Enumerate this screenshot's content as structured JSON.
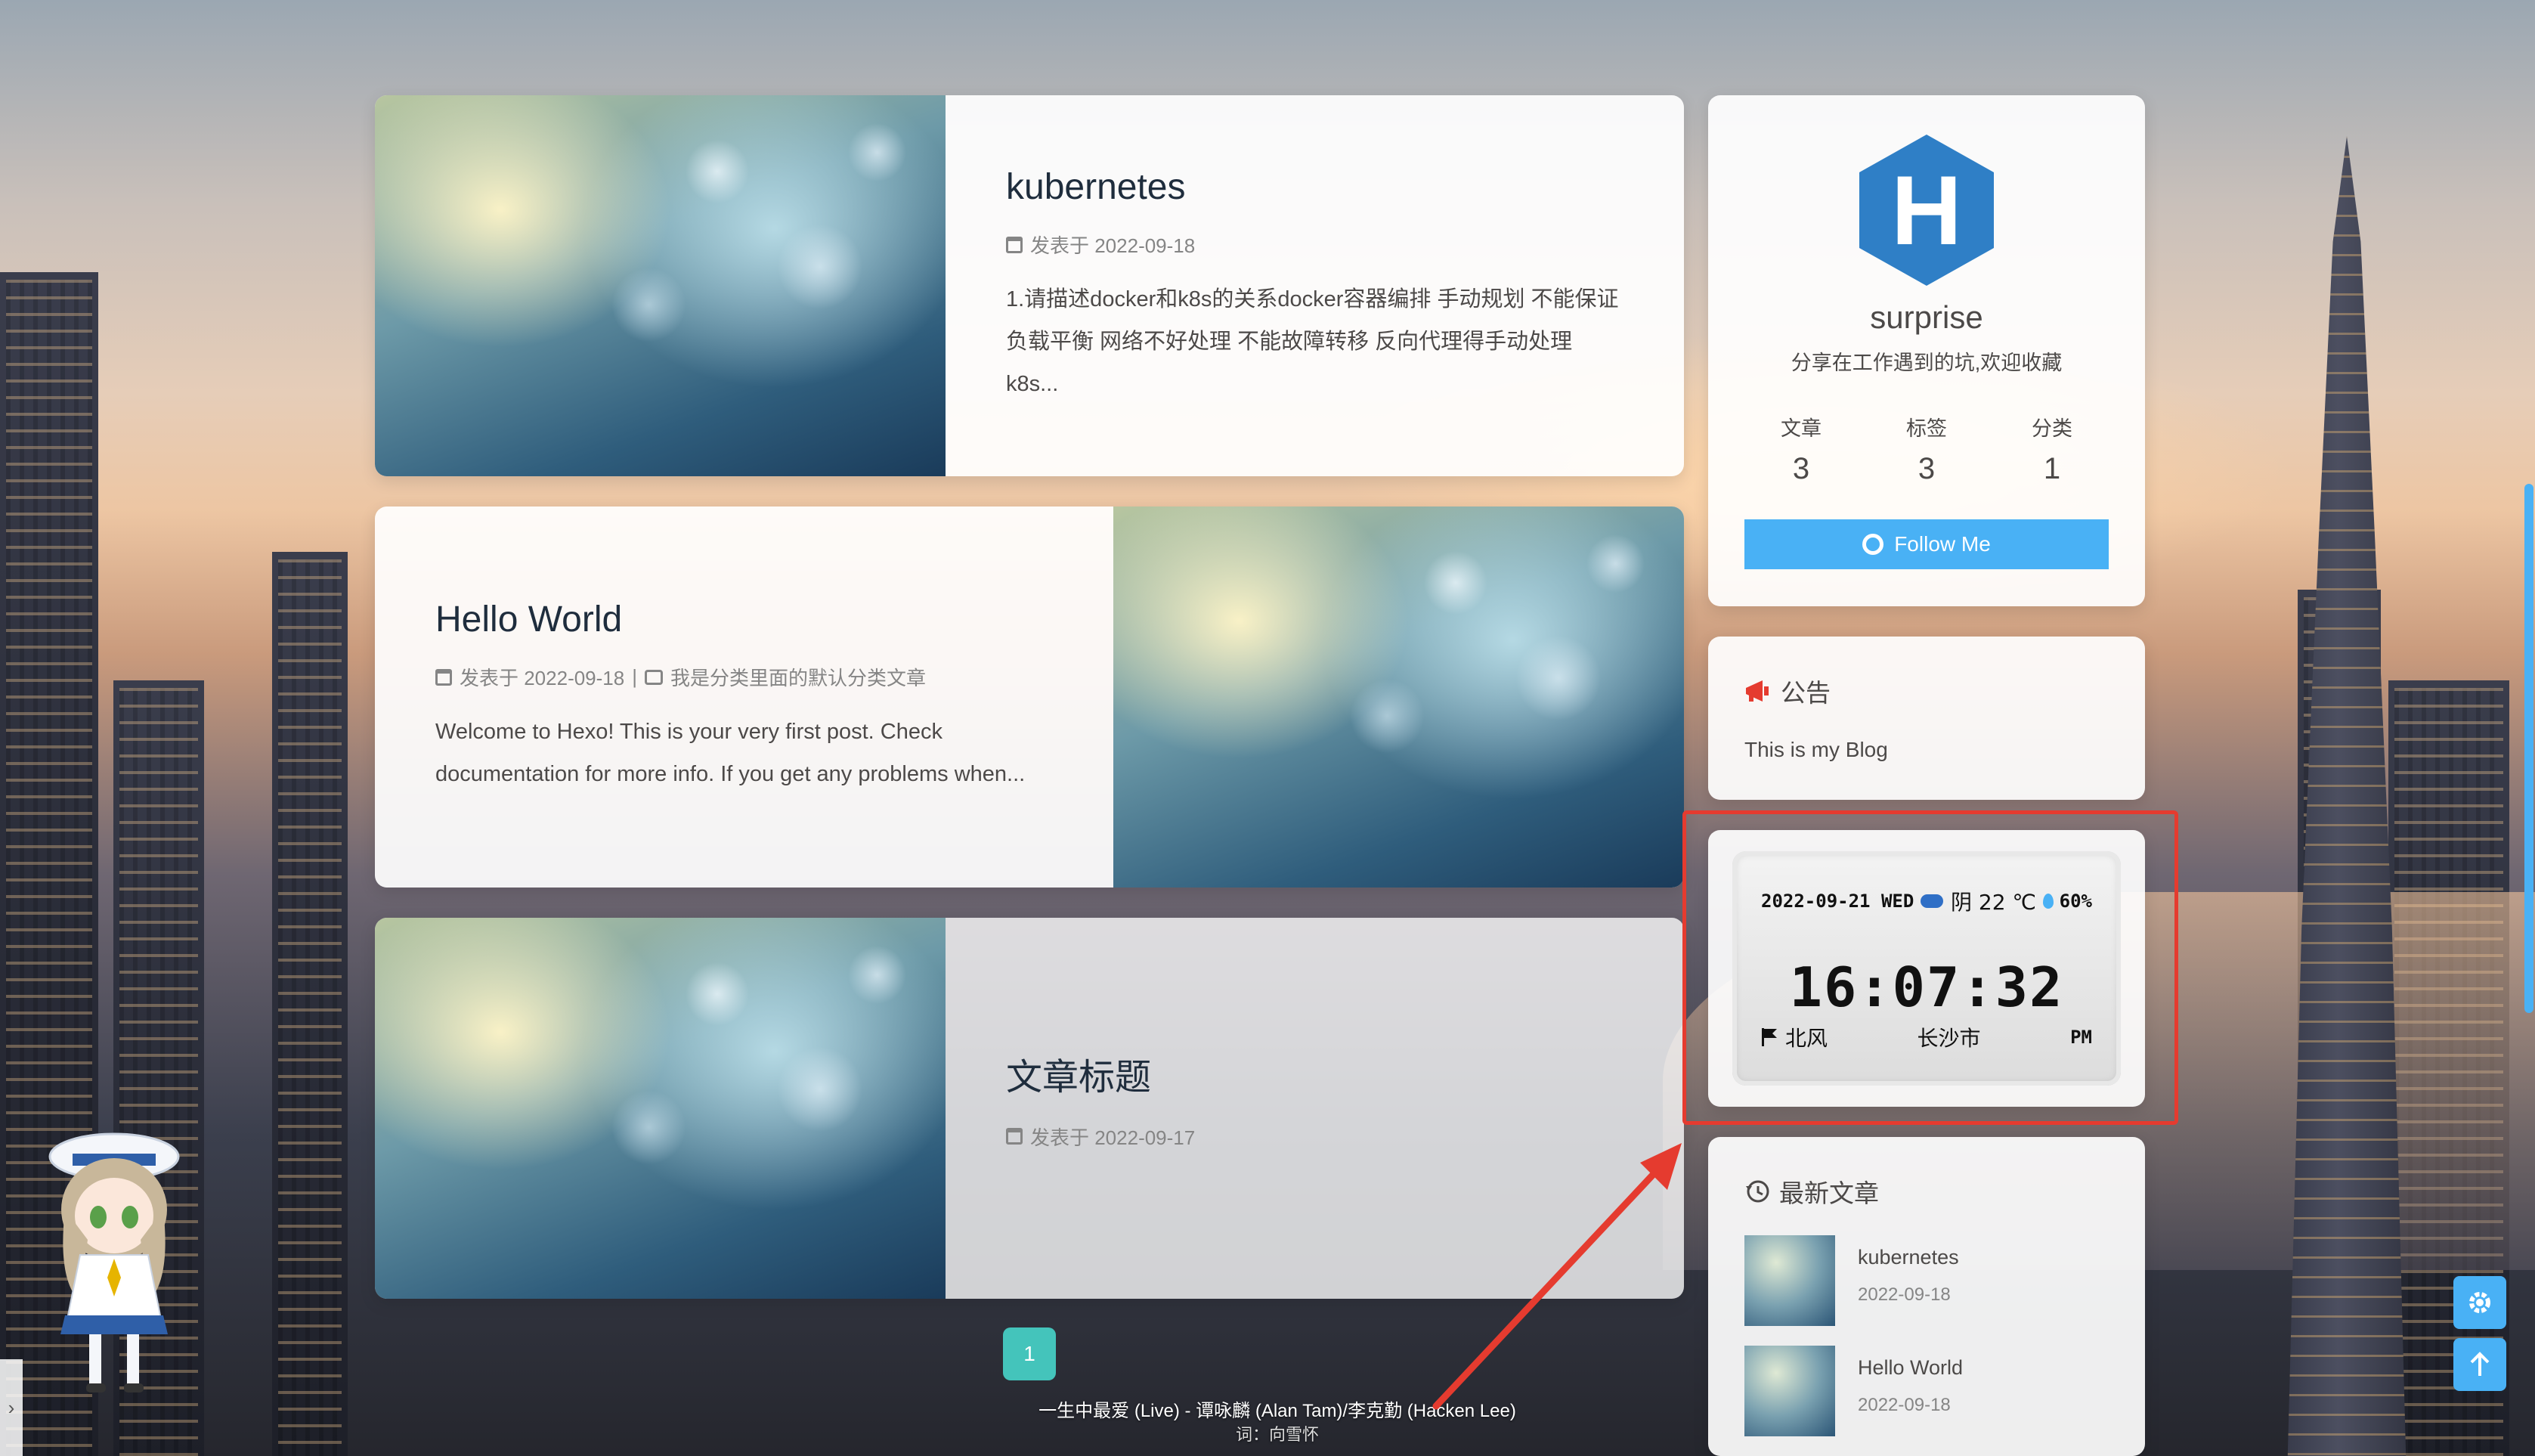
{
  "posts": [
    {
      "title": "kubernetes",
      "meta": "发表于 2022-09-18",
      "excerpt": "1.请描述docker和k8s的关系docker容器编排 手动规划 不能保证负载平衡 网络不好处理 不能故障转移 反向代理得手动处理 k8s..."
    },
    {
      "title": "Hello World",
      "meta": "发表于 2022-09-18",
      "category": "我是分类里面的默认分类文章",
      "excerpt": "Welcome to Hexo! This is your very first post. Check documentation for more info. If you get any problems when..."
    },
    {
      "title": "文章标题",
      "meta": "发表于 2022-09-17"
    }
  ],
  "author": {
    "logo_letter": "H",
    "name": "surprise",
    "description": "分享在工作遇到的坑,欢迎收藏",
    "stats": [
      {
        "label": "文章",
        "value": "3"
      },
      {
        "label": "标签",
        "value": "3"
      },
      {
        "label": "分类",
        "value": "1"
      }
    ],
    "follow_label": "Follow Me"
  },
  "announcement": {
    "title": "公告",
    "content": "This is my Blog"
  },
  "weather": {
    "date": "2022-09-21 WED",
    "condition": "阴 22 ℃",
    "humidity": "60%",
    "time": "16:07:32",
    "wind": "北风",
    "city": "长沙市",
    "ampm": "PM"
  },
  "recent": {
    "title": "最新文章",
    "items": [
      {
        "title": "kubernetes",
        "date": "2022-09-18"
      },
      {
        "title": "Hello World",
        "date": "2022-09-18"
      }
    ]
  },
  "pagination": {
    "current": "1"
  },
  "music": {
    "title": "一生中最爱 (Live) - 谭咏麟 (Alan Tam)/李克勤 (Hacken Lee)",
    "lyric": "词：向雪怀"
  },
  "colors": {
    "accent": "#49b1f5",
    "page_active": "#44c4bb",
    "highlight": "#e53b2f",
    "hexo": "#2f7fc6"
  }
}
